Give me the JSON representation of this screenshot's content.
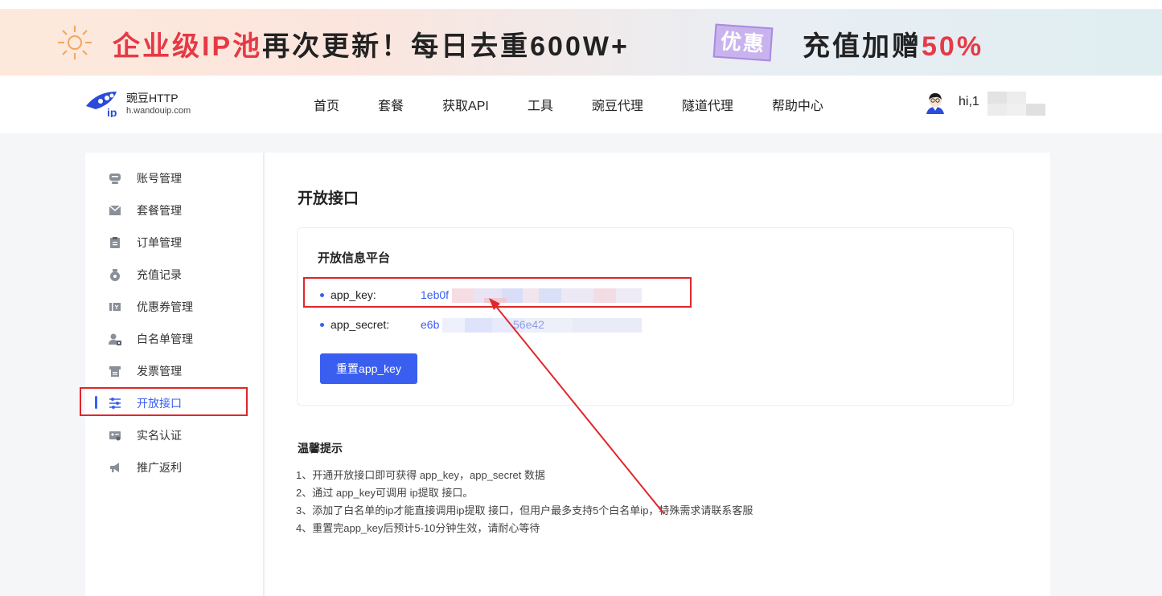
{
  "banner": {
    "part1": "企业级IP池",
    "part2": "再次更新！每日去重600W+",
    "tag": "优惠",
    "part3": "充值加赠",
    "part4": "50%"
  },
  "logo": {
    "title": "豌豆HTTP",
    "sub": "h.wandouip.com"
  },
  "nav": {
    "items": [
      "首页",
      "套餐",
      "获取API",
      "工具",
      "豌豆代理",
      "隧道代理",
      "帮助中心"
    ]
  },
  "user": {
    "greeting": "hi,1"
  },
  "sidebar": {
    "items": [
      {
        "label": "账号管理",
        "icon": "account-icon"
      },
      {
        "label": "套餐管理",
        "icon": "package-icon"
      },
      {
        "label": "订单管理",
        "icon": "order-icon"
      },
      {
        "label": "充值记录",
        "icon": "recharge-icon"
      },
      {
        "label": "优惠券管理",
        "icon": "coupon-icon"
      },
      {
        "label": "白名单管理",
        "icon": "whitelist-icon"
      },
      {
        "label": "发票管理",
        "icon": "invoice-icon"
      },
      {
        "label": "开放接口",
        "icon": "api-settings-icon",
        "active": true
      },
      {
        "label": "实名认证",
        "icon": "id-card-icon"
      },
      {
        "label": "推广返利",
        "icon": "megaphone-icon"
      }
    ]
  },
  "main": {
    "title": "开放接口",
    "card_title": "开放信息平台",
    "app_key_label": "app_key:",
    "app_key_value": "1eb0f",
    "app_secret_label": "app_secret:",
    "app_secret_value_start": "e6b",
    "app_secret_value_partial": "56e42",
    "reset_button": "重置app_key",
    "tips_title": "温馨提示",
    "tips": [
      "1、开通开放接口即可获得 app_key，app_secret 数据",
      "2、通过 app_key可调用 ip提取 接口。",
      "3、添加了白名单的ip才能直接调用ip提取 接口，但用户最多支持5个白名单ip，特殊需求请联系客服",
      "4、重置完app_key后预计5-10分钟生效，请耐心等待"
    ]
  },
  "colors": {
    "accent": "#3a5ef0",
    "annotation": "#e0262b"
  }
}
